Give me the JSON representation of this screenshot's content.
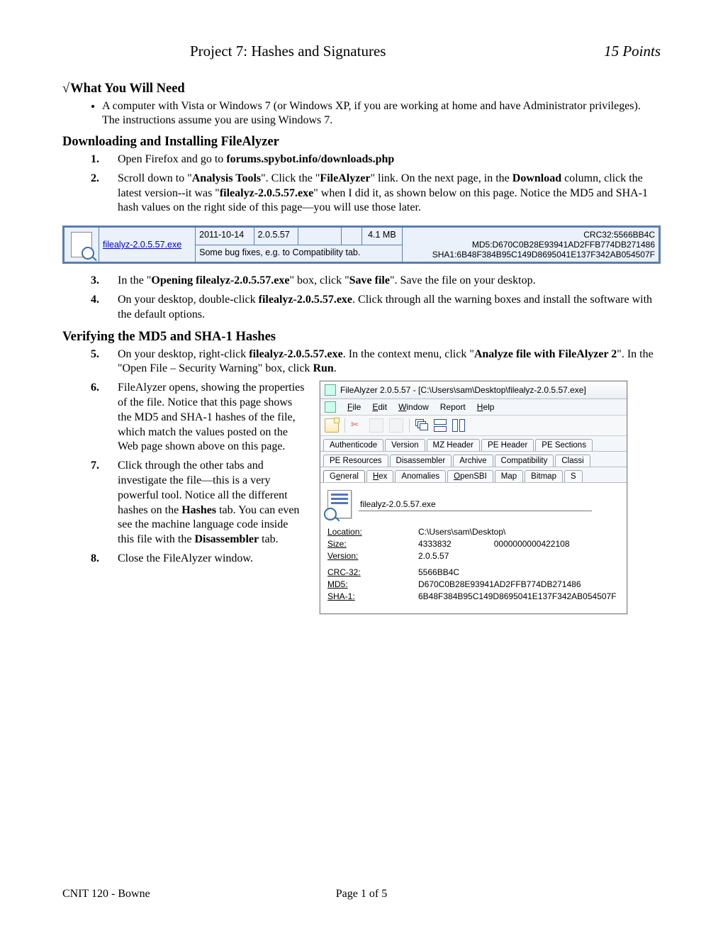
{
  "header": {
    "title": "Project 7: Hashes and Signatures",
    "points": "15 Points"
  },
  "sections": {
    "need": {
      "heading": "What You Will Need",
      "bullet": "A computer with Vista or Windows 7 (or Windows XP, if you are working at home and have Administrator privileges).  The instructions assume you are using Windows 7."
    },
    "download": {
      "heading": "Downloading and Installing FileAlyzer",
      "step1_a": "Open Firefox and go to ",
      "step1_b": "forums.spybot.info/downloads.php",
      "step2_a": "Scroll down to \"",
      "step2_b": "Analysis Tools",
      "step2_c": "\".  Click the \"",
      "step2_d": "FileAlyzer",
      "step2_e": "\" link.  On the next page, in the ",
      "step2_f": "Download",
      "step2_g": " column, click the latest version--it was \"",
      "step2_h": "filealyz-2.0.5.57.exe",
      "step2_i": "\" when I did it, as shown below on this page.  Notice the MD5 and SHA-1 hash values on the right side of this page—you will use those later.",
      "step3_a": "In the \"",
      "step3_b": "Opening filealyz-2.0.5.57.exe",
      "step3_c": "\" box, click \"",
      "step3_d": "Save file",
      "step3_e": "\".  Save the file on your desktop.",
      "step4_a": "On your desktop, double-click ",
      "step4_b": "filealyz-2.0.5.57.exe",
      "step4_c": ".  Click through all the warning boxes and install the software with the default options."
    },
    "verify": {
      "heading": "Verifying the MD5 and SHA-1 Hashes",
      "step5_a": "On your desktop, right-click ",
      "step5_b": "filealyz-2.0.5.57.exe",
      "step5_c": ".  In the context menu, click \"",
      "step5_d": "Analyze file with FileAlyzer 2",
      "step5_e": "\".  In the \"Open File – Security Warning\" box, click ",
      "step5_f": "Run",
      "step5_g": ".",
      "step6_a": "FileAlyzer opens, showing the properties of the file.  Notice that this page shows the MD5 and SHA-1 hashes of the file, which match the values posted on the Web page shown above on this page.",
      "step7_a": "Click through the other tabs and investigate the file—this is a very powerful tool.  Notice all the different hashes on the ",
      "step7_b": "Hashes",
      "step7_c": " tab.  You can even see the machine language code inside this file with the ",
      "step7_d": "Disassembler",
      "step7_e": " tab.",
      "step8": "Close the FileAlyzer window."
    }
  },
  "dl_table": {
    "link": "filealyz-2.0.5.57.exe",
    "date": "2011-10-14",
    "version": "2.0.5.57",
    "size": "4.1 MB",
    "desc": "Some bug fixes, e.g. to Compatibility tab.",
    "crc": "CRC32:5566BB4C",
    "md5": "MD5:D670C0B28E93941AD2FFB774DB271486",
    "sha1": "SHA1:6B48F384B95C149D8695041E137F342AB054507F"
  },
  "fa": {
    "title": "FileAlyzer 2.0.5.57 - [C:\\Users\\sam\\Desktop\\filealyz-2.0.5.57.exe]",
    "menu": {
      "file": "File",
      "edit": "Edit",
      "window": "Window",
      "report": "Report",
      "help": "Help"
    },
    "tabs_row1": [
      "Authenticode",
      "Version",
      "MZ Header",
      "PE Header",
      "PE Sections"
    ],
    "tabs_row2": [
      "PE Resources",
      "Disassembler",
      "Archive",
      "Compatibility",
      "Classi"
    ],
    "tabs_row3": [
      "General",
      "Hex",
      "Anomalies",
      "OpenSBI",
      "Map",
      "Bitmap",
      "S"
    ],
    "filename": "filealyz-2.0.5.57.exe",
    "kv": {
      "location_k": "Location:",
      "location_v": "C:\\Users\\sam\\Desktop\\",
      "size_k": "Size:",
      "size_v": "4333832",
      "size_v2": "0000000000422108",
      "version_k": "Version:",
      "version_v": "2.0.5.57",
      "crc_k": "CRC-32:",
      "crc_v": "5566BB4C",
      "md5_k": "MD5:",
      "md5_v": "D670C0B28E93941AD2FFB774DB271486",
      "sha1_k": "SHA-1:",
      "sha1_v": "6B48F384B95C149D8695041E137F342AB054507F"
    }
  },
  "footer": {
    "left": "CNIT 120 - Bowne",
    "center": "Page 1 of 5"
  }
}
